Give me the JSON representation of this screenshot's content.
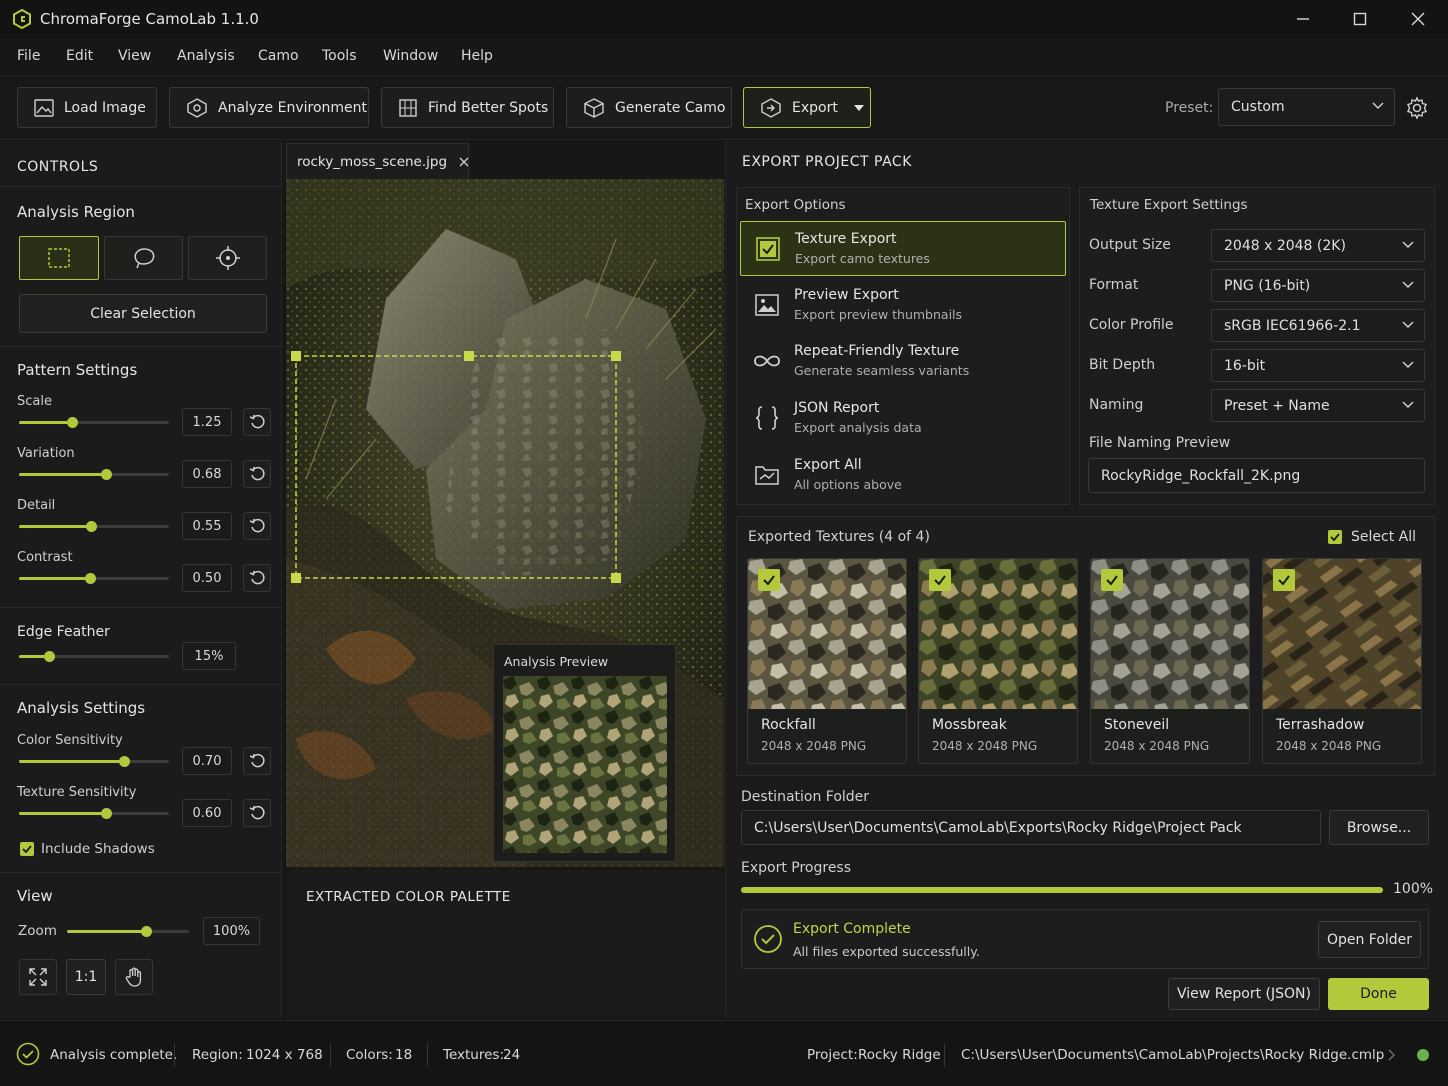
{
  "app": {
    "title": "ChromaForge CamoLab 1.1.0"
  },
  "menu": [
    "File",
    "Edit",
    "View",
    "Analysis",
    "Camo",
    "Tools",
    "Window",
    "Help"
  ],
  "toolbar": {
    "load": "Load Image",
    "analyze": "Analyze Environment",
    "find": "Find Better Spots",
    "generate": "Generate Camo",
    "export": "Export",
    "preset_label": "Preset:",
    "preset_value": "Custom"
  },
  "controls": {
    "title": "CONTROLS",
    "analysis_region": "Analysis Region",
    "clear_selection": "Clear Selection",
    "pattern_settings": "Pattern Settings",
    "sliders": [
      {
        "label": "Scale",
        "value": "1.25",
        "level": 0.35
      },
      {
        "label": "Variation",
        "value": "0.68",
        "level": 0.58
      },
      {
        "label": "Detail",
        "value": "0.55",
        "level": 0.48
      },
      {
        "label": "Contrast",
        "value": "0.50",
        "level": 0.47
      }
    ],
    "edge_feather": {
      "label": "Edge Feather",
      "value": "15%",
      "level": 0.2
    },
    "analysis_settings": "Analysis Settings",
    "color_sensitivity": {
      "label": "Color Sensitivity",
      "value": "0.70",
      "level": 0.7
    },
    "texture_sensitivity": {
      "label": "Texture Sensitivity",
      "value": "0.60",
      "level": 0.58
    },
    "include_shadows": "Include Shadows",
    "view": "View",
    "zoom_label": "Zoom",
    "zoom_value": "100%",
    "zoom_level": 0.65,
    "one_to_one": "1:1"
  },
  "canvas": {
    "tab": "rocky_moss_scene.jpg",
    "analysis_preview": "Analysis Preview",
    "palette_title": "EXTRACTED COLOR PALETTE",
    "palette": [
      "#2b2a18",
      "#4a4c24",
      "#80846a",
      "#5c3e24",
      "#7a4612",
      "#2a2016",
      "#6a6762"
    ]
  },
  "export": {
    "title": "EXPORT PROJECT PACK",
    "options_title": "Export Options",
    "options": [
      {
        "title": "Texture Export",
        "sub": "Export camo textures"
      },
      {
        "title": "Preview Export",
        "sub": "Export preview thumbnails"
      },
      {
        "title": "Repeat-Friendly Texture",
        "sub": "Generate seamless variants"
      },
      {
        "title": "JSON Report",
        "sub": "Export analysis data"
      },
      {
        "title": "Export All",
        "sub": "All options above"
      }
    ],
    "settings_title": "Texture Export Settings",
    "settings": [
      {
        "label": "Output Size",
        "value": "2048 x 2048 (2K)"
      },
      {
        "label": "Format",
        "value": "PNG (16-bit)"
      },
      {
        "label": "Color Profile",
        "value": "sRGB IEC61966-2.1"
      },
      {
        "label": "Bit Depth",
        "value": "16-bit"
      },
      {
        "label": "Naming",
        "value": "Preset + Name"
      }
    ],
    "naming_preview_label": "File Naming Preview",
    "naming_preview": "RockyRidge_Rockfall_2K.png",
    "exported_title": "Exported Textures (4 of 4)",
    "select_all": "Select All",
    "textures": [
      {
        "name": "Rockfall",
        "size": "2048 x 2048 PNG"
      },
      {
        "name": "Mossbreak",
        "size": "2048 x 2048 PNG"
      },
      {
        "name": "Stoneveil",
        "size": "2048 x 2048 PNG"
      },
      {
        "name": "Terrashadow",
        "size": "2048 x 2048 PNG"
      }
    ],
    "dest_label": "Destination Folder",
    "dest_path": "C:\\Users\\User\\Documents\\CamoLab\\Exports\\Rocky Ridge\\Project Pack",
    "browse": "Browse...",
    "progress_label": "Export Progress",
    "progress_value": "100%",
    "progress": 1.0,
    "complete_title": "Export Complete",
    "complete_sub": "All files exported successfully.",
    "open_folder": "Open Folder",
    "view_report": "View Report (JSON)",
    "done": "Done"
  },
  "status": {
    "message": "Analysis complete.",
    "region_label": "Region:",
    "region": "1024 x 768",
    "colors_label": "Colors:",
    "colors": "18",
    "textures_label": "Textures:",
    "textures": "24",
    "project_label": "Project:",
    "project": "Rocky Ridge",
    "path": "C:\\Users\\User\\Documents\\CamoLab\\Projects\\Rocky Ridge.cmlp"
  },
  "colors": {
    "accent": "#b4c83c"
  }
}
